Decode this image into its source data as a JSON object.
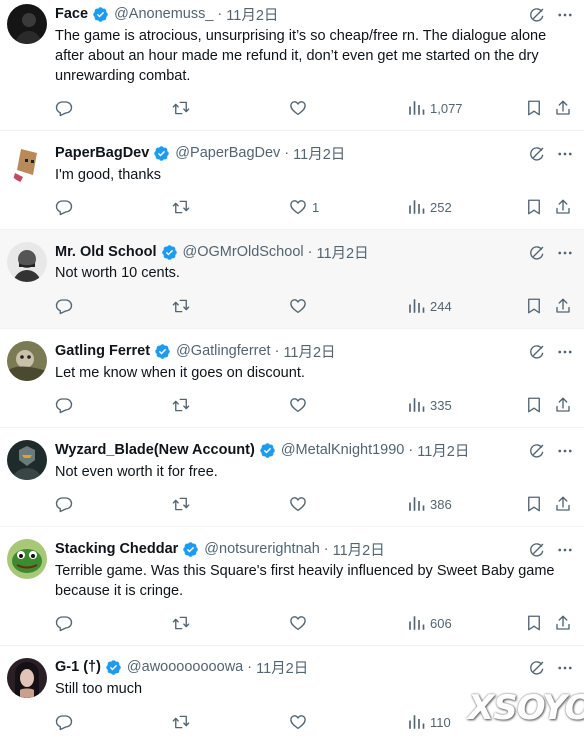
{
  "tweets": [
    {
      "name": "Face",
      "handle": "@Anonemuss_",
      "sep": "·",
      "date": "11月2日",
      "text": "The game is atrocious, unsurprising it’s so cheap/free rn. The dialogue alone after about an hour made me refund it, don’t even get me started on the dry unrewarding combat.",
      "likes": "",
      "views": "1,077",
      "avatar_color": "#1a1a1a"
    },
    {
      "name": "PaperBagDev",
      "handle": "@PaperBagDev",
      "sep": "·",
      "date": "11月2日",
      "text": "I'm good, thanks",
      "likes": "1",
      "views": "252",
      "avatar_color": "#b88a5a"
    },
    {
      "name": "Mr. Old School",
      "handle": "@OGMrOldSchool",
      "sep": "·",
      "date": "11月2日",
      "text": "Not worth 10 cents.",
      "likes": "",
      "views": "244",
      "avatar_color": "#888888"
    },
    {
      "name": "Gatling Ferret",
      "handle": "@Gatlingferret",
      "sep": "·",
      "date": "11月2日",
      "text": "Let me know when it goes on discount.",
      "likes": "",
      "views": "335",
      "avatar_color": "#6b6a4a"
    },
    {
      "name": "Wyzard_Blade(New Account)",
      "handle": "@MetalKnight1990",
      "sep": "·",
      "date": "11月2日",
      "text": "Not even worth it for free.",
      "likes": "",
      "views": "386",
      "avatar_color": "#2e3a3a"
    },
    {
      "name": "Stacking Cheddar",
      "handle": "@notsurerightnah",
      "sep": "·",
      "date": "11月2日",
      "text": "Terrible game.  Was this Square's first heavily influenced by Sweet Baby game because it is cringe.",
      "likes": "",
      "views": "606",
      "avatar_color": "#3e8a2e"
    },
    {
      "name": "G-1 (†)",
      "handle": "@awoooooooowa",
      "sep": "·",
      "date": "11月2日",
      "text": "Still too much",
      "likes": "",
      "views": "110",
      "avatar_color": "#3a2b2b"
    }
  ],
  "watermark": "XSOYO",
  "colors": {
    "verified": "#1d9bf0",
    "muted": "#536471",
    "text": "#0f1419",
    "divider": "#eff3f4",
    "hover": "#f7f7f7"
  },
  "icons": [
    "verified-badge-icon",
    "grok-icon",
    "more-icon",
    "reply-icon",
    "retweet-icon",
    "like-icon",
    "views-icon",
    "bookmark-icon",
    "share-icon"
  ]
}
